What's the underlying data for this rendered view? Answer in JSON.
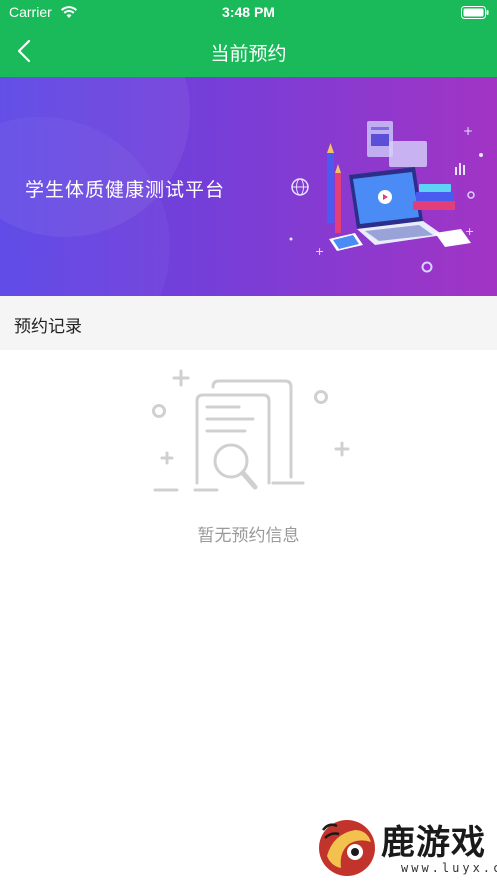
{
  "status_bar": {
    "carrier": "Carrier",
    "time": "3:48 PM"
  },
  "nav": {
    "title": "当前预约",
    "back_icon": "chevron-left-icon"
  },
  "banner": {
    "text": "学生体质健康测试平台"
  },
  "section": {
    "title": "预约记录"
  },
  "empty_state": {
    "text": "暂无预约信息",
    "icon": "document-search-icon"
  },
  "watermark": {
    "name": "鹿游戏",
    "url": "www.luyx.cn"
  },
  "colors": {
    "nav_green": "#1aba5a",
    "section_bg": "#f5f5f5",
    "empty_text": "#9a9a9a"
  }
}
